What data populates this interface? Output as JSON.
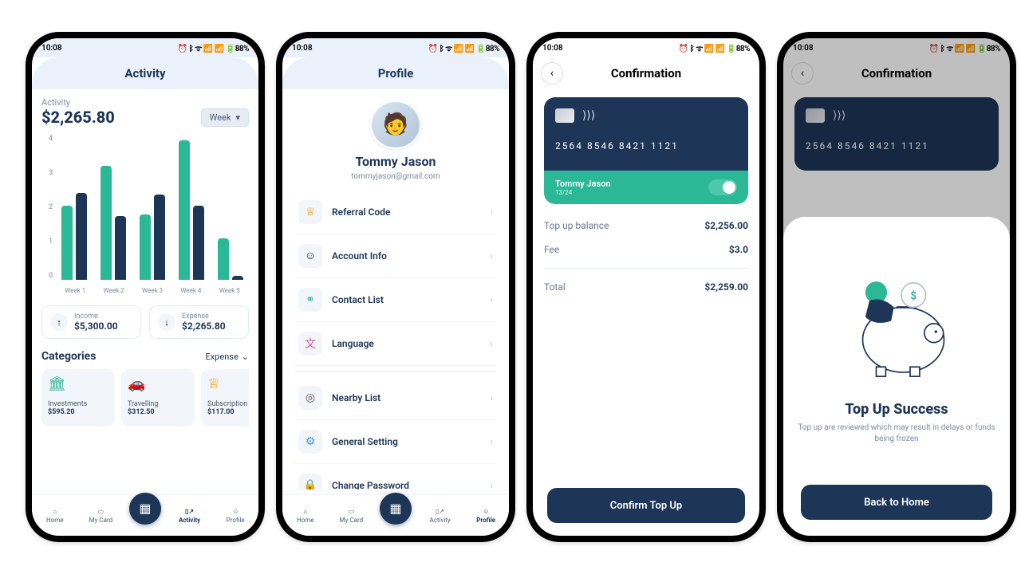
{
  "status": {
    "time": "10:08",
    "indicators": "⏰ ᛒ ᯤ 📶 📶 🔋88%"
  },
  "screen1": {
    "title": "Activity",
    "activity_label": "Activity",
    "amount": "$2,265.80",
    "period_selector": "Week",
    "yticks": [
      "4",
      "3",
      "2",
      "1",
      "0"
    ],
    "xlabels": [
      "Week 1",
      "Week 2",
      "Week 3",
      "Week 4",
      "Week 5"
    ],
    "income_label": "Income",
    "income_value": "$5,300.00",
    "expense_label": "Expense",
    "expense_value": "$2,265.80",
    "categories_label": "Categories",
    "categories_filter": "Expense",
    "cats": [
      {
        "name": "Investments",
        "amount": "$595.20"
      },
      {
        "name": "Travelling",
        "amount": "$312.50"
      },
      {
        "name": "Subscription",
        "amount": "$117.00"
      }
    ]
  },
  "screen2": {
    "title": "Profile",
    "name": "Tommy Jason",
    "email": "tommyjason@gmail.com",
    "items_a": [
      "Referral Code",
      "Account Info",
      "Contact List",
      "Language"
    ],
    "items_b": [
      "Nearby List",
      "General Setting",
      "Change Password"
    ]
  },
  "screen3": {
    "title": "Confirmation",
    "card_number": "2564  8546  8421  1121",
    "card_name": "Tommy Jason",
    "card_exp": "13/24",
    "rows": [
      {
        "k": "Top up balance",
        "v": "$2,256.00"
      },
      {
        "k": "Fee",
        "v": "$3.0"
      }
    ],
    "total_label": "Total",
    "total_value": "$2,259.00",
    "button": "Confirm Top Up"
  },
  "screen4": {
    "title": "Confirmation",
    "card_number": "2564  8546  8421  1121",
    "success_title": "Top Up Success",
    "success_text": "Top up are reviewed which may result in delays or funds being frozen",
    "button": "Back to Home"
  },
  "tabbar": {
    "home": "Home",
    "mycard": "My Card",
    "activity": "Activity",
    "profile": "Profile"
  },
  "chart_data": {
    "type": "bar",
    "categories": [
      "Week 1",
      "Week 2",
      "Week 3",
      "Week 4",
      "Week 5"
    ],
    "series": [
      {
        "name": "Income",
        "values": [
          2.05,
          3.15,
          1.8,
          3.85,
          1.15
        ]
      },
      {
        "name": "Expense",
        "values": [
          2.4,
          1.75,
          2.35,
          2.05,
          0.1
        ]
      }
    ],
    "ylim": [
      0,
      4
    ],
    "ylabel": "",
    "xlabel": ""
  }
}
